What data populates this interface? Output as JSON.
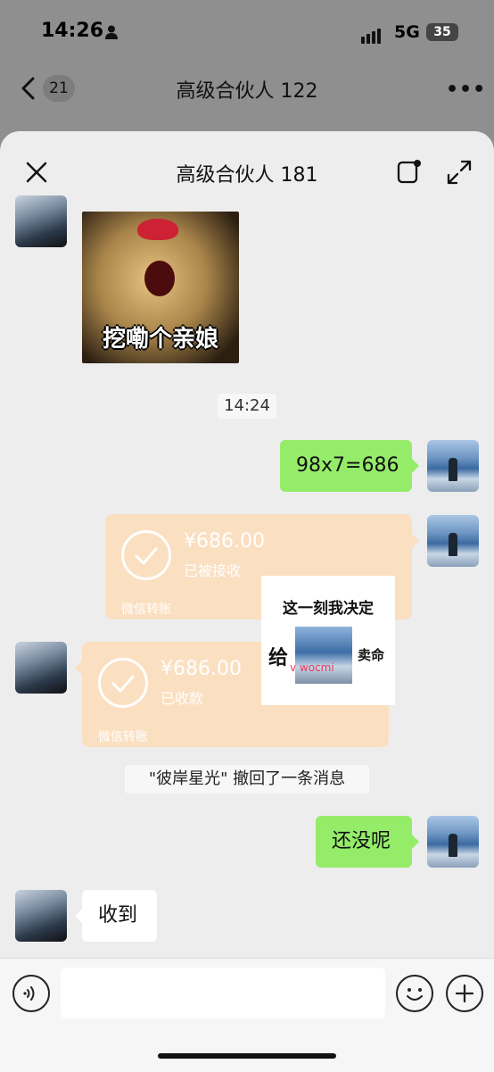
{
  "status_bar": {
    "time": "14:26",
    "network": "5G",
    "battery": "35"
  },
  "background_chat": {
    "unread_count": "21",
    "title": "高级合伙人 122"
  },
  "sheet": {
    "title": "高级合伙人 181"
  },
  "messages": {
    "sticker_caption": "挖嘞个亲娘",
    "timestamp": "14:24",
    "outgoing_calc": "98x7=686",
    "transfer_out": {
      "amount": "¥686.00",
      "status": "已被接收",
      "footer": "微信转账"
    },
    "transfer_in": {
      "amount": "¥686.00",
      "status": "已收款",
      "footer": "微信转账"
    },
    "recall_notice": "\"彼岸星光\" 撤回了一条消息",
    "outgoing_reply": "还没呢",
    "incoming_reply": "收到"
  },
  "overlay_sign": {
    "line1": "这一刻我决定",
    "give": "给",
    "sell": "卖命",
    "watermark": "v wocmi"
  },
  "colors": {
    "green_bubble": "#95ec69",
    "transfer_card": "#fbdfc1",
    "sheet_bg": "#ededed"
  },
  "icons": {
    "back": "chevron-left-icon",
    "more": "more-icon",
    "close": "close-icon",
    "float": "floating-window-icon",
    "expand": "expand-icon",
    "voice": "voice-icon",
    "emoji": "emoji-icon",
    "plus": "plus-icon"
  }
}
